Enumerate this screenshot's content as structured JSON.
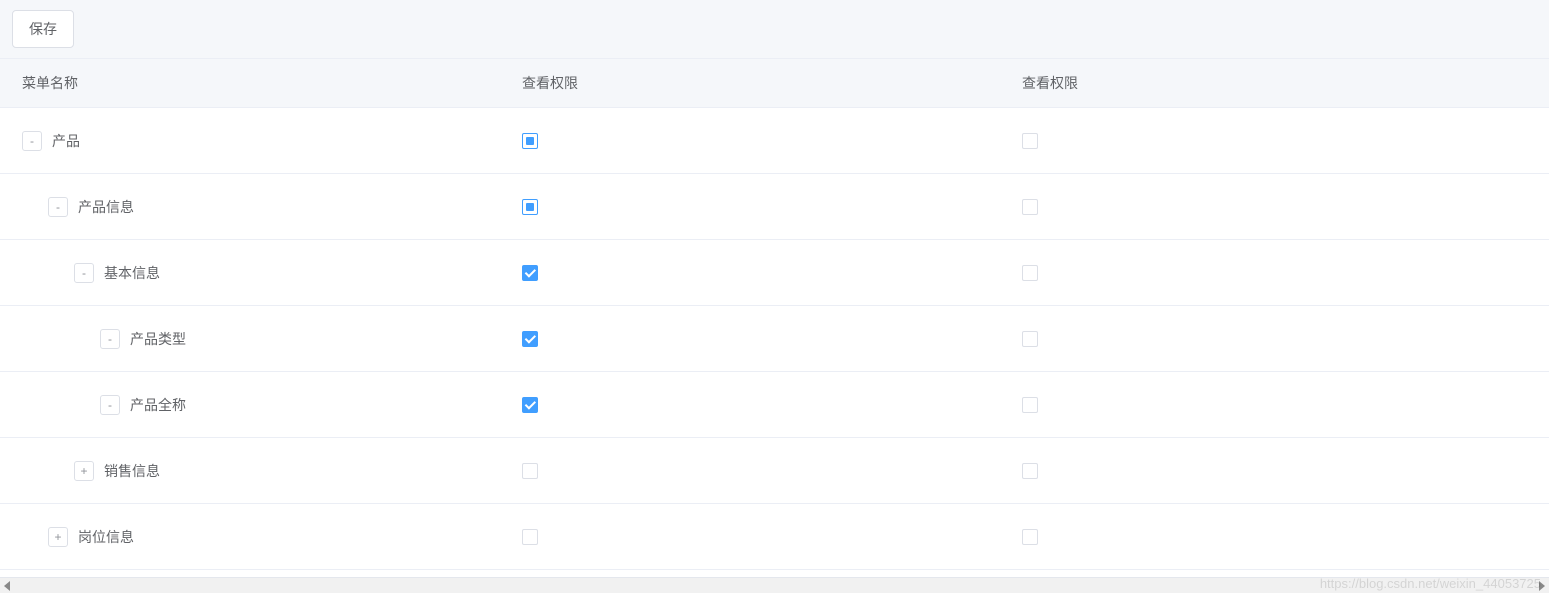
{
  "toolbar": {
    "save_label": "保存"
  },
  "columns": {
    "name": "菜单名称",
    "perm1": "查看权限",
    "perm2": "查看权限"
  },
  "rows": [
    {
      "label": "产品",
      "level": 0,
      "expander": "-",
      "perm1": "indeterminate",
      "perm2": "unchecked"
    },
    {
      "label": "产品信息",
      "level": 1,
      "expander": "-",
      "perm1": "indeterminate",
      "perm2": "unchecked"
    },
    {
      "label": "基本信息",
      "level": 2,
      "expander": "-",
      "perm1": "checked",
      "perm2": "unchecked"
    },
    {
      "label": "产品类型",
      "level": 3,
      "expander": "-",
      "perm1": "checked",
      "perm2": "unchecked"
    },
    {
      "label": "产品全称",
      "level": 3,
      "expander": "-",
      "perm1": "checked",
      "perm2": "unchecked"
    },
    {
      "label": "销售信息",
      "level": 2,
      "expander": "+",
      "perm1": "unchecked",
      "perm2": "unchecked"
    },
    {
      "label": "岗位信息",
      "level": 1,
      "expander": "+",
      "perm1": "unchecked",
      "perm2": "unchecked"
    }
  ],
  "watermark": "https://blog.csdn.net/weixin_44053725"
}
